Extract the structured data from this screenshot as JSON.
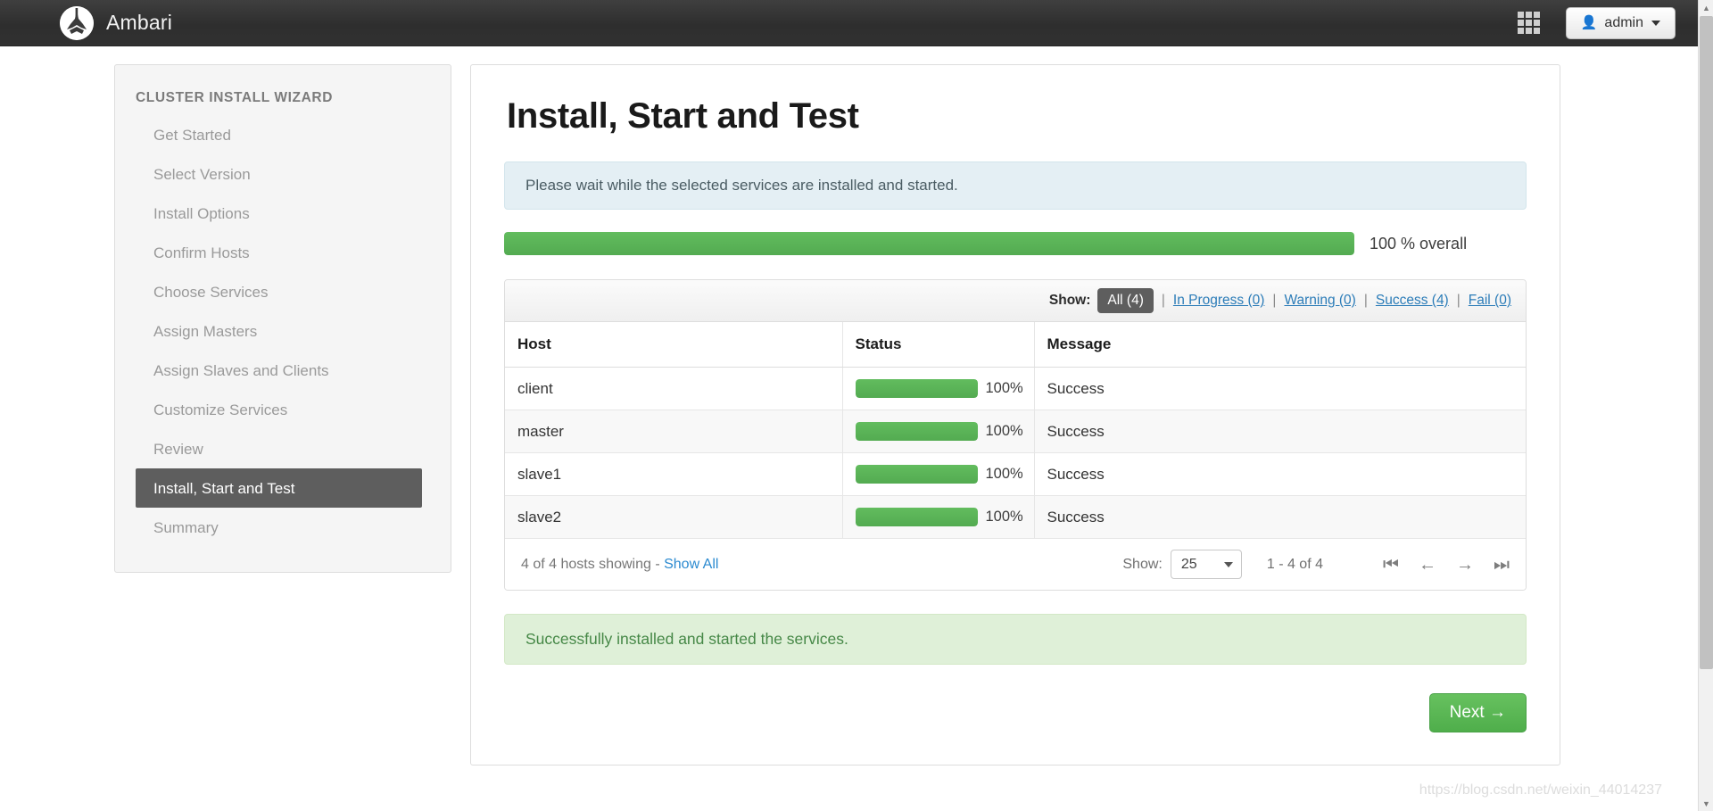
{
  "navbar": {
    "brand_title": "Ambari",
    "grid_icon": "apps-grid-icon",
    "user_icon": "user-icon",
    "admin_label": "admin"
  },
  "sidebar": {
    "title": "CLUSTER INSTALL WIZARD",
    "items": [
      {
        "label": "Get Started",
        "active": false
      },
      {
        "label": "Select Version",
        "active": false
      },
      {
        "label": "Install Options",
        "active": false
      },
      {
        "label": "Confirm Hosts",
        "active": false
      },
      {
        "label": "Choose Services",
        "active": false
      },
      {
        "label": "Assign Masters",
        "active": false
      },
      {
        "label": "Assign Slaves and Clients",
        "active": false
      },
      {
        "label": "Customize Services",
        "active": false
      },
      {
        "label": "Review",
        "active": false
      },
      {
        "label": "Install, Start and Test",
        "active": true
      },
      {
        "label": "Summary",
        "active": false
      }
    ]
  },
  "main": {
    "page_title": "Install, Start and Test",
    "info_alert": "Please wait while the selected services are installed and started.",
    "overall": {
      "percent": 100,
      "label": "100 % overall"
    },
    "filter": {
      "show_label": "Show:",
      "separator": "|",
      "options": [
        {
          "label": "All (4)",
          "active": true
        },
        {
          "label": "In Progress (0)",
          "active": false
        },
        {
          "label": "Warning (0)",
          "active": false
        },
        {
          "label": "Success (4)",
          "active": false
        },
        {
          "label": "Fail (0)",
          "active": false
        }
      ]
    },
    "table": {
      "columns": [
        "Host",
        "Status",
        "Message"
      ],
      "rows": [
        {
          "host": "client",
          "percent": 100,
          "percent_label": "100%",
          "message": "Success"
        },
        {
          "host": "master",
          "percent": 100,
          "percent_label": "100%",
          "message": "Success"
        },
        {
          "host": "slave1",
          "percent": 100,
          "percent_label": "100%",
          "message": "Success"
        },
        {
          "host": "slave2",
          "percent": 100,
          "percent_label": "100%",
          "message": "Success"
        }
      ]
    },
    "pagination": {
      "summary": "4 of 4 hosts showing - ",
      "show_all": "Show All",
      "show_label": "Show:",
      "page_size": "25",
      "range": "1 - 4 of 4",
      "first_icon": "⏮",
      "prev_icon": "←",
      "next_icon": "→",
      "last_icon": "⏭"
    },
    "success_alert": "Successfully installed and started the services.",
    "next_button": "Next →"
  },
  "watermark": "https://blog.csdn.net/weixin_44014237",
  "colors": {
    "progress_green": "#5cb85c",
    "success_text": "#4f9a4f",
    "link_blue": "#2b7cb8",
    "active_dark": "#5e5e5e",
    "info_bg": "#e4eff4",
    "success_bg": "#dff0d8"
  }
}
